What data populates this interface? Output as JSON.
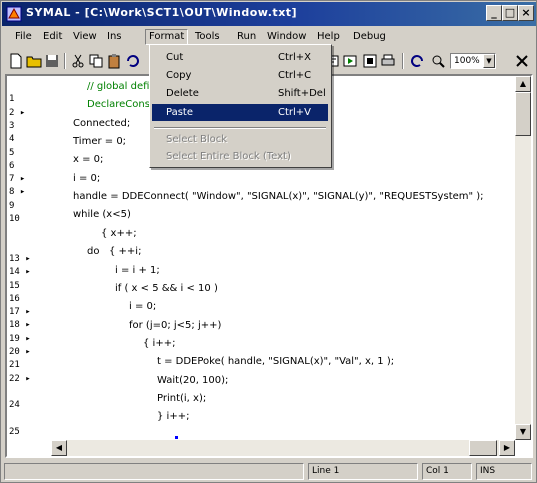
{
  "window": {
    "title": "SYMAL - [C:\\Work\\SCT1\\OUT\\Window.txt]",
    "buttons": {
      "minimize": "_",
      "maximize": "□",
      "close": "×"
    }
  },
  "menubar": {
    "items": [
      "File",
      "Edit",
      "View",
      "Ins",
      "Format",
      "Tools",
      "Run",
      "Window",
      "Help",
      "Debug"
    ],
    "active_index": 4
  },
  "dropdown": {
    "items": [
      {
        "label": "Cut",
        "shortcut": "Ctrl+X",
        "state": "normal"
      },
      {
        "label": "Copy",
        "shortcut": "Ctrl+C",
        "state": "normal"
      },
      {
        "label": "Delete",
        "shortcut": "Shift+Del",
        "state": "normal"
      },
      {
        "label": "Paste",
        "shortcut": "Ctrl+V",
        "state": "highlighted"
      },
      {
        "label": "Select Block",
        "shortcut": "",
        "state": "disabled"
      },
      {
        "label": "Select Entire Block (Text)",
        "shortcut": "",
        "state": "disabled"
      }
    ]
  },
  "toolbar": {
    "zoom_value": "100%",
    "icons": [
      "new-file-icon",
      "open-folder-icon",
      "save-icon",
      "cut-icon",
      "copy-icon",
      "paste-icon",
      "undo-icon",
      "redo-icon",
      "find-icon",
      "run-icon",
      "stop-icon",
      "print-icon",
      "zoom-icon"
    ]
  },
  "editor": {
    "line_numbers": [
      "",
      "1",
      "2 ▸",
      "3",
      "4",
      "5",
      "6",
      "7 ▸",
      "8 ▸",
      "9",
      "10",
      "",
      "",
      "13 ▸",
      "14 ▸",
      "15",
      "16",
      "17 ▸",
      "18 ▸",
      "19 ▸",
      "20 ▸",
      "21",
      "22 ▸",
      "",
      "24",
      "",
      "25"
    ],
    "lines": [
      {
        "indent": 2,
        "text": "// global definitions and",
        "style": "green"
      },
      {
        "indent": 2,
        "text": "DeclareConstant( \"...\" )",
        "style": "green"
      },
      {
        "indent": 1,
        "text": "Connected;",
        "style": "normal"
      },
      {
        "indent": 1,
        "text": "Timer = 0;",
        "style": "normal"
      },
      {
        "indent": 1,
        "text": "x = 0;",
        "style": "normal"
      },
      {
        "indent": 1,
        "text": "i = 0;",
        "style": "normal"
      },
      {
        "indent": 1,
        "text": "handle = DDEConnect( \"Window\", \"SIGNAL(x)\", \"SIGNAL(y)\", \"REQUESTSystem\" );",
        "style": "normal"
      },
      {
        "indent": 1,
        "text": "while (x<5)",
        "style": "normal"
      },
      {
        "indent": 3,
        "text": "{ x++;",
        "style": "normal"
      },
      {
        "indent": 2,
        "text": "do   { ++i;",
        "style": "normal"
      },
      {
        "indent": 4,
        "text": "i = i + 1;",
        "style": "normal"
      },
      {
        "indent": 4,
        "text": "if ( x < 5 && i < 10 )",
        "style": "normal"
      },
      {
        "indent": 5,
        "text": "i = 0;",
        "style": "normal"
      },
      {
        "indent": 5,
        "text": "for (j=0; j<5; j++)",
        "style": "normal"
      },
      {
        "indent": 6,
        "text": "{ i++;",
        "style": "normal"
      },
      {
        "indent": 7,
        "text": "t = DDEPoke( handle, \"SIGNAL(x)\", \"Val\", x, 1 );",
        "style": "normal"
      },
      {
        "indent": 7,
        "text": "Wait(20, 100);",
        "style": "normal"
      },
      {
        "indent": 7,
        "text": "Print(i, x);",
        "style": "normal"
      },
      {
        "indent": 7,
        "text": "} i++;",
        "style": "normal"
      }
    ]
  },
  "statusbar": {
    "panels": [
      "",
      "Line 1",
      "Col 1",
      "INS"
    ]
  }
}
